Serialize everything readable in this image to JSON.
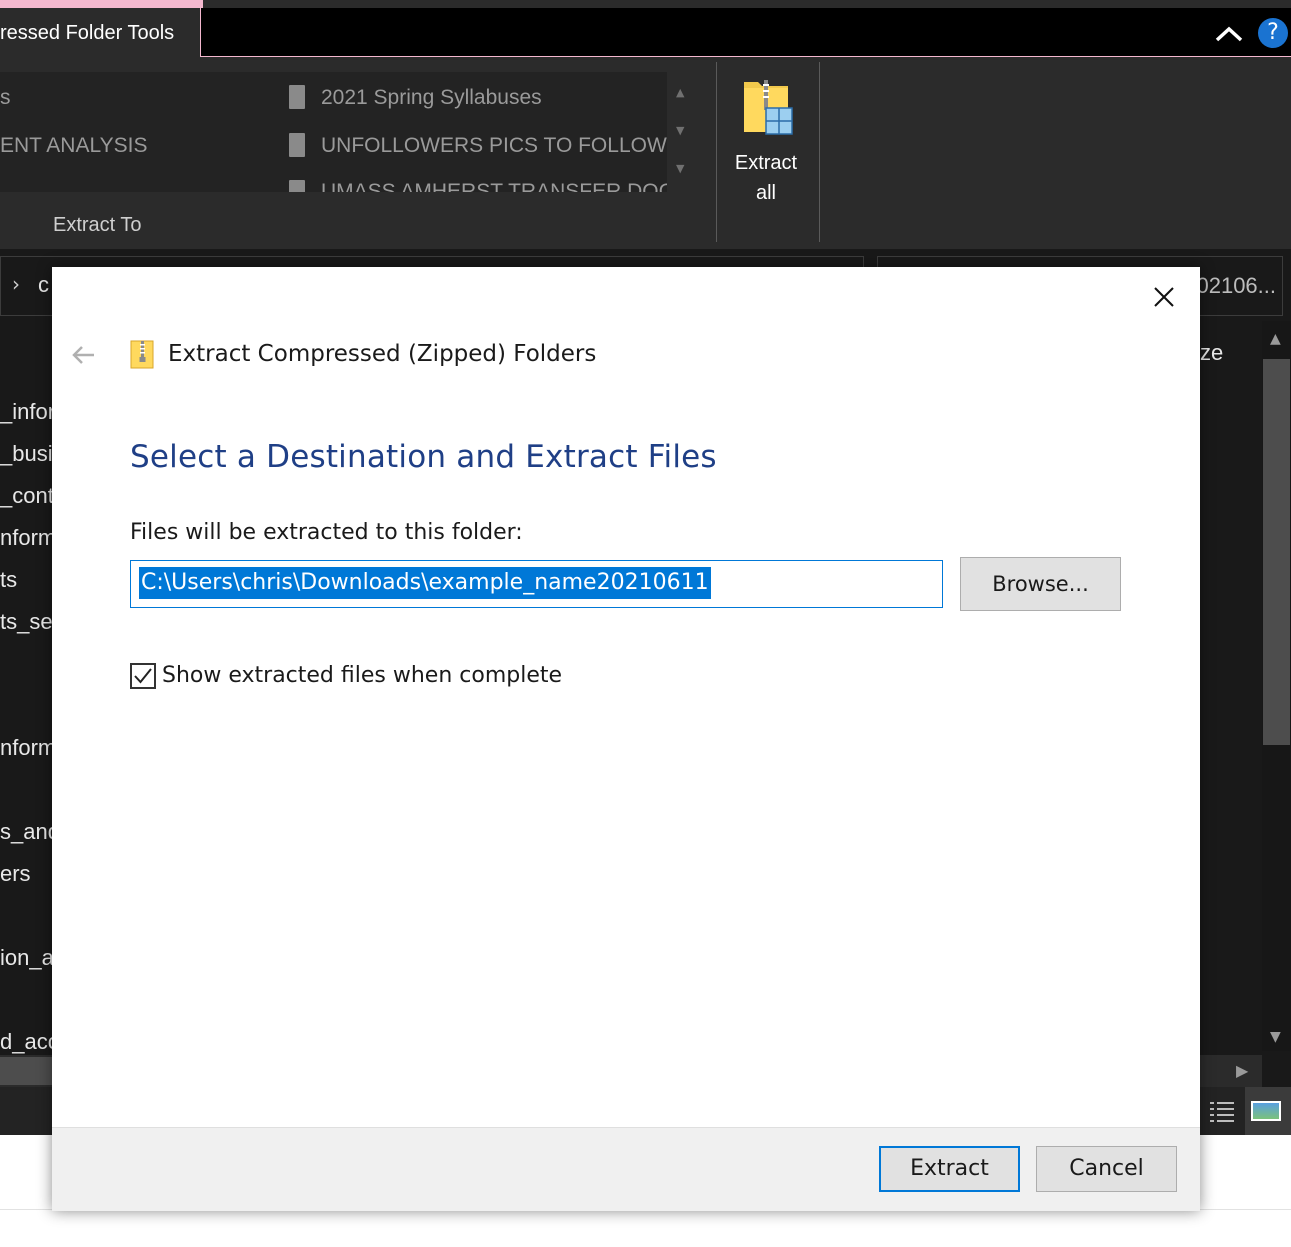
{
  "explorer": {
    "context_tab_label": "ressed Folder Tools",
    "help_glyph": "?",
    "ribbon": {
      "gallery_left_items": [
        "s",
        "ENT ANALYSIS"
      ],
      "gallery_right_items": [
        "2021 Spring Syllabuses",
        "UNFOLLOWERS PICS TO FOLLOW",
        "UMASS AMHERST TRANSFER DOCS"
      ],
      "extract_to_label": "Extract To",
      "extract_all_label_line1": "Extract",
      "extract_all_label_line2": "all"
    },
    "address": {
      "crumb_glyph": "›",
      "crumb_text": "c",
      "search_text": "02106..."
    },
    "file_list": [
      "_infor",
      "_busi",
      "_cont",
      "nform",
      "ts",
      "ts_se",
      "nform",
      "s_and",
      "ers",
      "ion_a",
      "d_acc"
    ],
    "column_header_fragment": "ze"
  },
  "dialog": {
    "title": "Extract Compressed (Zipped) Folders",
    "heading": "Select a Destination and Extract Files",
    "destination_label": "Files will be extracted to this folder:",
    "destination_path": "C:\\Users\\chris\\Downloads\\example_name20210611",
    "browse_label": "Browse...",
    "show_files_label": "Show extracted files when complete",
    "show_files_checked": true,
    "extract_label": "Extract",
    "cancel_label": "Cancel"
  },
  "colors": {
    "accent": "#0078d7",
    "heading": "#1f3f86",
    "explorer_bg": "#191919",
    "ribbon_bg": "#2b2b2b",
    "context_tab_accent": "#f4b8cf"
  },
  "icons": [
    "collapse-ribbon-icon",
    "help-icon",
    "zip-folder-icon",
    "close-icon",
    "back-arrow-icon",
    "checkmark-icon",
    "details-view-icon",
    "thumbnails-view-icon"
  ]
}
